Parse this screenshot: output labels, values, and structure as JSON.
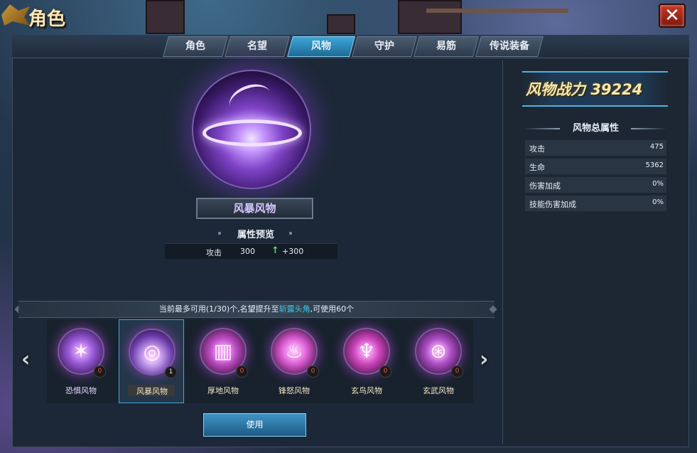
{
  "window": {
    "title": "角色",
    "close_label": "✕"
  },
  "tabs": [
    {
      "label": "角色",
      "active": false
    },
    {
      "label": "名望",
      "active": false
    },
    {
      "label": "风物",
      "active": true
    },
    {
      "label": "守护",
      "active": false
    },
    {
      "label": "易筋",
      "active": false
    },
    {
      "label": "传说装备",
      "active": false
    }
  ],
  "selected_item": {
    "name": "风暴风物",
    "preview_title": "属性预览",
    "preview": {
      "attr": "攻击",
      "value": "300",
      "bonus": "+300"
    }
  },
  "info": {
    "prefix": "当前最多可用(1/30)个,名望提升至",
    "highlight": "斩露头角",
    "suffix": ",可使用60个"
  },
  "carousel": {
    "prev_icon": "‹",
    "next_icon": "›",
    "items": [
      {
        "name": "恐惧风物",
        "count": "0",
        "icon": "fear-emblem-icon",
        "color": "#9a5ad8",
        "name_color": "#e6d2ff"
      },
      {
        "name": "风暴风物",
        "count": "1",
        "icon": "storm-vortex-icon",
        "color": "#b08ae0",
        "name_color": "#f2e6c8"
      },
      {
        "name": "厚地风物",
        "count": "0",
        "icon": "earth-pillar-icon",
        "color": "#c050c8",
        "name_color": "#f2e6c8"
      },
      {
        "name": "锋怒风物",
        "count": "0",
        "icon": "rage-flame-icon",
        "color": "#e060d8",
        "name_color": "#f2e6c8"
      },
      {
        "name": "玄鸟风物",
        "count": "0",
        "icon": "phoenix-flame-icon",
        "color": "#d048c0",
        "name_color": "#f2e6c8"
      },
      {
        "name": "玄武风物",
        "count": "0",
        "icon": "planet-orbit-icon",
        "color": "#b050c8",
        "name_color": "#f2e6c8"
      }
    ]
  },
  "use_button": "使用",
  "right_panel": {
    "power_label": "风物战力",
    "power_value": "39224",
    "attr_title": "风物总属性",
    "attrs": [
      {
        "label": "攻击",
        "value": "475"
      },
      {
        "label": "生命",
        "value": "5362"
      },
      {
        "label": "伤害加成",
        "value": "0%"
      },
      {
        "label": "技能伤害加成",
        "value": "0%"
      }
    ]
  }
}
